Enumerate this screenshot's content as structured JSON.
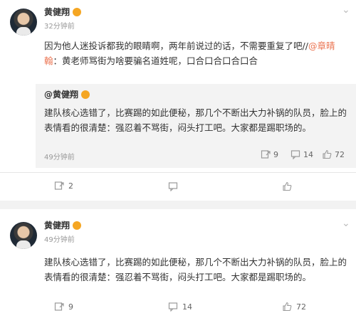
{
  "post1": {
    "username": "黄健翔",
    "time": "32分钟前",
    "text_pre": "因为他人迷投诉都我的眼睛啊，两年前说过的话，不需要重复了吧//",
    "mention": "@章晴翰",
    "text_post": "：黄老师骂街为啥要骗名道姓呢，口合口合口合口合",
    "quote": {
      "author": "@黄健翔",
      "text": "建队核心选错了，比赛踢的如此便秘，那几个不断出大力补锅的队员，脸上的表情看的很清楚：强忍着不骂街，闷头打工吧。大家都是踢职场的。",
      "time": "49分钟前",
      "repost_count": "9",
      "comment_count": "14",
      "like_count": "72"
    },
    "actions": {
      "repost": "2",
      "comment": "",
      "like": ""
    }
  },
  "post2": {
    "username": "黄健翔",
    "time": "49分钟前",
    "text": "建队核心选错了，比赛踢的如此便秘，那几个不断出大力补锅的队员，脸上的表情看的很清楚：强忍着不骂街，闷头打工吧。大家都是踢职场的。",
    "actions": {
      "repost": "9",
      "comment": "14",
      "like": "72"
    }
  },
  "colors": {
    "mention": "#eb7350",
    "badge": "#f5a623",
    "gap": "#f2f2f2"
  }
}
